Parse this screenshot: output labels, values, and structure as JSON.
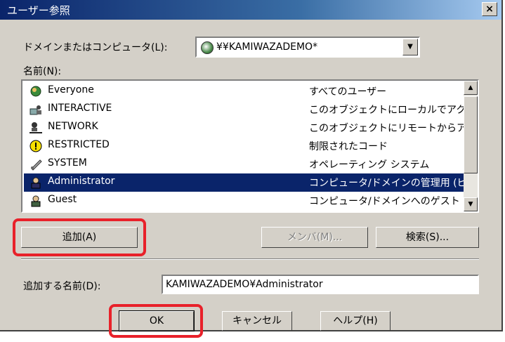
{
  "window": {
    "title": "ユーザー参照",
    "close": "×"
  },
  "domain": {
    "label": "ドメインまたはコンピュータ(L):",
    "value": "¥¥KAMIWAZADEMO*",
    "arrow": "▼"
  },
  "names_label": "名前(N):",
  "list": [
    {
      "name": "Everyone",
      "desc": "すべてのユーザー",
      "icon": "globe-group-icon"
    },
    {
      "name": "INTERACTIVE",
      "desc": "このオブジェクトにローカルでアクセス",
      "icon": "interactive-user-icon"
    },
    {
      "name": "NETWORK",
      "desc": "このオブジェクトにリモートからアクセ",
      "icon": "network-user-icon"
    },
    {
      "name": "RESTRICTED",
      "desc": "制限されたコード",
      "icon": "warning-icon"
    },
    {
      "name": "SYSTEM",
      "desc": "オペレーティング システム",
      "icon": "system-icon"
    },
    {
      "name": "Administrator",
      "desc": "コンピュータ/ドメインの管理用 (ビ",
      "icon": "user-icon",
      "selected": true
    },
    {
      "name": "Guest",
      "desc": "コンピュータ/ドメインへのゲスト アク",
      "icon": "user-icon"
    }
  ],
  "buttons": {
    "add": "追加(A)",
    "members": "メンバ(M)...",
    "search": "検索(S)...",
    "ok": "OK",
    "cancel": "キャンセル",
    "help": "ヘルプ(H)"
  },
  "add_name": {
    "label": "追加する名前(D):",
    "value": "KAMIWAZADEMO¥Administrator"
  },
  "colors": {
    "highlight": "#e8212a",
    "selection": "#0a246a",
    "face": "#d4d0c8"
  }
}
